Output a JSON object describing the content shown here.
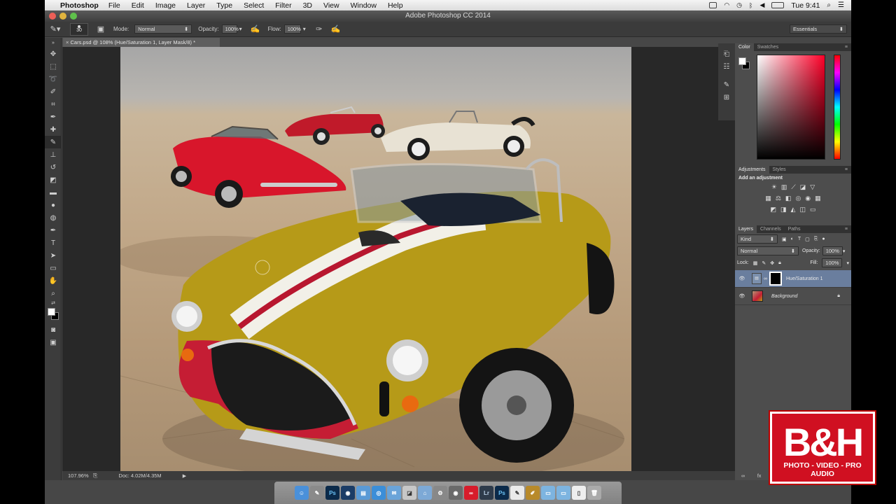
{
  "menubar": {
    "app": "Photoshop",
    "items": [
      "File",
      "Edit",
      "Image",
      "Layer",
      "Type",
      "Select",
      "Filter",
      "3D",
      "View",
      "Window",
      "Help"
    ],
    "clock": "Tue 9:41"
  },
  "window": {
    "title": "Adobe Photoshop CC 2014"
  },
  "options": {
    "brush_size": "30",
    "mode_label": "Mode:",
    "mode_value": "Normal",
    "opacity_label": "Opacity:",
    "opacity_value": "100%",
    "flow_label": "Flow:",
    "flow_value": "100%",
    "workspace": "Essentials"
  },
  "document": {
    "tab": "Cars.psd @ 108% (Hue/Saturation 1, Layer Mask/8) *",
    "zoom": "107.96%",
    "doc_size": "Doc: 4.02M/4.35M"
  },
  "color_panel": {
    "tabs": [
      "Color",
      "Swatches"
    ]
  },
  "adjustments_panel": {
    "tabs": [
      "Adjustments",
      "Styles"
    ],
    "heading": "Add an adjustment"
  },
  "layers_panel": {
    "tabs": [
      "Layers",
      "Channels",
      "Paths"
    ],
    "filter": "Kind",
    "blend_mode": "Normal",
    "opacity_label": "Opacity:",
    "opacity_value": "100%",
    "lock_label": "Lock:",
    "fill_label": "Fill:",
    "fill_value": "100%",
    "layers": [
      {
        "name": "Hue/Saturation 1"
      },
      {
        "name": "Background"
      }
    ]
  },
  "dock_apps": [
    "Ps",
    "Lr",
    "Ps"
  ],
  "logo": {
    "text": "B&H",
    "tagline": "PHOTO - VIDEO - PRO AUDIO"
  },
  "colors": {
    "accent_red": "#d01021",
    "panel": "#4d4d4d"
  }
}
